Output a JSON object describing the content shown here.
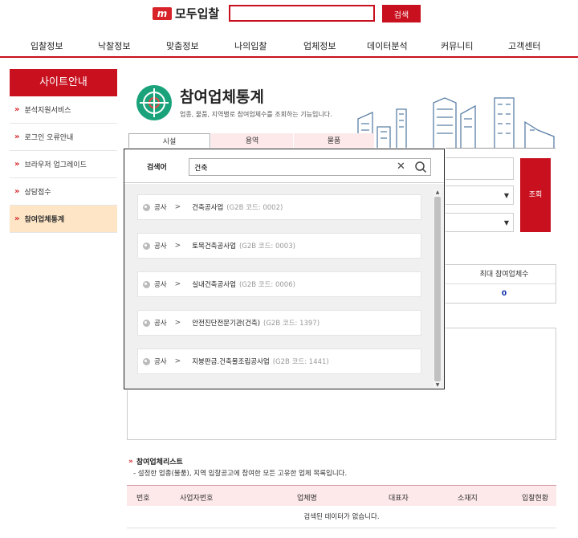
{
  "header": {
    "logo_mark": "m",
    "logo_text": "모두입찰",
    "search_button": "검색"
  },
  "nav": [
    "입찰정보",
    "낙찰정보",
    "맞춤정보",
    "나의입찰",
    "업체정보",
    "데이터분석",
    "커뮤니티",
    "고객센터"
  ],
  "sidebar": {
    "title": "사이트안내",
    "items": [
      {
        "label": "분석지원서비스",
        "active": false
      },
      {
        "label": "로그인 오류안내",
        "active": false
      },
      {
        "label": "브라우저 업그레이드",
        "active": false
      },
      {
        "label": "상담접수",
        "active": false
      },
      {
        "label": "참여업체통계",
        "active": true
      }
    ]
  },
  "page": {
    "title": "참여업체통계",
    "description": "업종, 물품, 지역별로 참여업체수를 조회하는 기능입니다."
  },
  "tabs": [
    "시설",
    "용역",
    "물품"
  ],
  "form": {
    "query_button": "조회"
  },
  "stats": {
    "header": "최대 참여업체수",
    "value": "0"
  },
  "popup": {
    "label": "검색어",
    "query": "건축",
    "results": [
      {
        "category": "공사",
        "name": "건축공사업",
        "code": "(G2B 코드: 0002)"
      },
      {
        "category": "공사",
        "name": "토목건축공사업",
        "code": "(G2B 코드: 0003)"
      },
      {
        "category": "공사",
        "name": "실내건축공사업",
        "code": "(G2B 코드: 0006)"
      },
      {
        "category": "공사",
        "name": "안전진단전문기관(건축)",
        "code": "(G2B 코드: 1397)"
      },
      {
        "category": "공사",
        "name": "지붕판금.건축물조립공사업",
        "code": "(G2B 코드: 1441)"
      }
    ]
  },
  "list": {
    "title": "참여업체리스트",
    "description": "- 설정한 업종(물품), 지역 입찰공고에 참여한 모든 고유한 업체 목록입니다.",
    "columns": [
      "번호",
      "사업자번호",
      "업체명",
      "대표자",
      "소재지",
      "입찰현황"
    ],
    "empty": "검색된 데이터가 없습니다."
  },
  "colors": {
    "brand_red": "#c8101e",
    "active_side": "#fde5c5",
    "tab_pink": "#fde8ea",
    "icon_green": "#1aa37a"
  }
}
